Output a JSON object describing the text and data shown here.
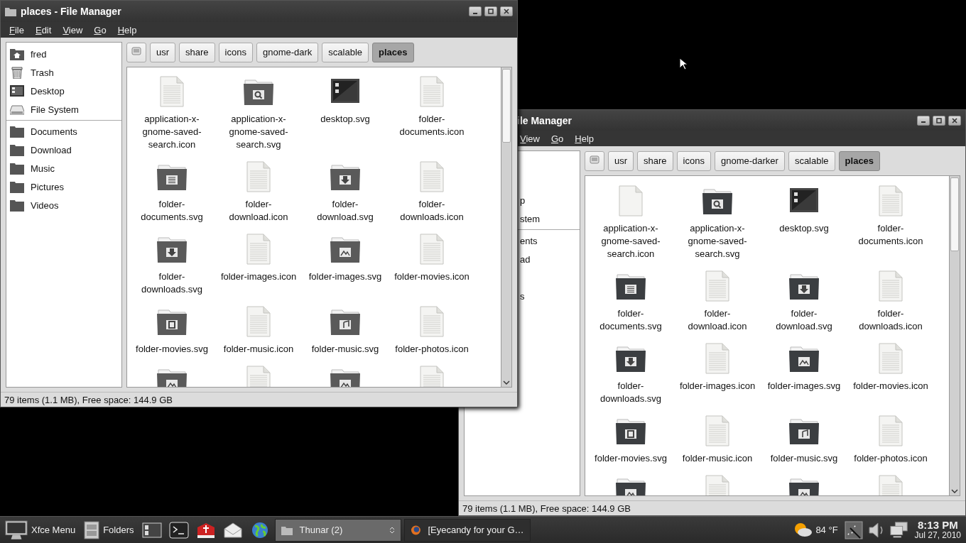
{
  "windows": [
    {
      "title": "places - File Manager",
      "menu": [
        "File",
        "Edit",
        "View",
        "Go",
        "Help"
      ],
      "sidebar": {
        "places": [
          {
            "label": "fred",
            "kind": "home"
          },
          {
            "label": "Trash",
            "kind": "trash"
          },
          {
            "label": "Desktop",
            "kind": "desktop"
          },
          {
            "label": "File System",
            "kind": "drive"
          }
        ],
        "bookmarks": [
          {
            "label": "Documents",
            "kind": "folder"
          },
          {
            "label": "Download",
            "kind": "folder"
          },
          {
            "label": "Music",
            "kind": "folder"
          },
          {
            "label": "Pictures",
            "kind": "folder"
          },
          {
            "label": "Videos",
            "kind": "folder"
          }
        ]
      },
      "path": [
        {
          "label": "usr",
          "selected": false
        },
        {
          "label": "share",
          "selected": false
        },
        {
          "label": "icons",
          "selected": false
        },
        {
          "label": "gnome-dark",
          "selected": false
        },
        {
          "label": "scalable",
          "selected": false
        },
        {
          "label": "places",
          "selected": true
        }
      ],
      "items": [
        {
          "name": "application-x-gnome-saved-search.icon",
          "kind": "document"
        },
        {
          "name": "application-x-gnome-saved-search.svg",
          "kind": "search-folder"
        },
        {
          "name": "desktop.svg",
          "kind": "desktop"
        },
        {
          "name": "folder-documents.icon",
          "kind": "document"
        },
        {
          "name": "folder-documents.svg",
          "kind": "documents-folder"
        },
        {
          "name": "folder-download.icon",
          "kind": "document"
        },
        {
          "name": "folder-download.svg",
          "kind": "download-folder"
        },
        {
          "name": "folder-downloads.icon",
          "kind": "document"
        },
        {
          "name": "folder-downloads.svg",
          "kind": "download-folder"
        },
        {
          "name": "folder-images.icon",
          "kind": "document"
        },
        {
          "name": "folder-images.svg",
          "kind": "images-folder"
        },
        {
          "name": "folder-movies.icon",
          "kind": "document"
        },
        {
          "name": "folder-movies.svg",
          "kind": "movies-folder"
        },
        {
          "name": "folder-music.icon",
          "kind": "document"
        },
        {
          "name": "folder-music.svg",
          "kind": "music-folder"
        },
        {
          "name": "folder-photos.icon",
          "kind": "document"
        },
        {
          "kind": "images-folder"
        },
        {
          "kind": "document"
        },
        {
          "kind": "images-folder"
        },
        {
          "kind": "document"
        }
      ],
      "status": "79 items (1.1 MB), Free space: 144.9 GB"
    },
    {
      "title": "ile Manager",
      "menu": [
        "View",
        "Go",
        "Help"
      ],
      "sidebar": {
        "places": [
          {
            "label": "p"
          },
          {
            "label": "stem"
          }
        ],
        "bookmarks": [
          {
            "label": "ents"
          },
          {
            "label": "ad"
          },
          {
            "label": "s"
          }
        ]
      },
      "path": [
        {
          "label": "usr",
          "selected": false
        },
        {
          "label": "share",
          "selected": false
        },
        {
          "label": "icons",
          "selected": false
        },
        {
          "label": "gnome-darker",
          "selected": false
        },
        {
          "label": "scalable",
          "selected": false
        },
        {
          "label": "places",
          "selected": true
        }
      ],
      "items": [
        {
          "name": "application-x-gnome-saved-search.icon",
          "kind": "blank"
        },
        {
          "name": "application-x-gnome-saved-search.svg",
          "kind": "search-folder"
        },
        {
          "name": "desktop.svg",
          "kind": "desktop"
        },
        {
          "name": "folder-documents.icon",
          "kind": "document"
        },
        {
          "name": "folder-documents.svg",
          "kind": "documents-folder"
        },
        {
          "name": "folder-download.icon",
          "kind": "document"
        },
        {
          "name": "folder-download.svg",
          "kind": "download-folder"
        },
        {
          "name": "folder-downloads.icon",
          "kind": "document"
        },
        {
          "name": "folder-downloads.svg",
          "kind": "download-folder"
        },
        {
          "name": "folder-images.icon",
          "kind": "document"
        },
        {
          "name": "folder-images.svg",
          "kind": "images-folder"
        },
        {
          "name": "folder-movies.icon",
          "kind": "document"
        },
        {
          "name": "folder-movies.svg",
          "kind": "movies-folder"
        },
        {
          "name": "folder-music.icon",
          "kind": "document"
        },
        {
          "name": "folder-music.svg",
          "kind": "music-folder"
        },
        {
          "name": "folder-photos.icon",
          "kind": "document"
        },
        {
          "kind": "images-folder"
        },
        {
          "kind": "document"
        },
        {
          "kind": "images-folder"
        },
        {
          "kind": "document"
        }
      ],
      "status": "79 items (1.1 MB), Free space: 144.9 GB"
    }
  ],
  "taskbar": {
    "menu": "Xfce Menu",
    "folders": "Folders",
    "launchers": [
      {
        "kind": "desktop"
      },
      {
        "kind": "terminal"
      },
      {
        "kind": "book"
      },
      {
        "kind": "mail"
      },
      {
        "kind": "globe"
      }
    ],
    "tasks": [
      {
        "label": "Thunar (2)",
        "kind": "folder",
        "selected": true
      },
      {
        "label": "[Eyecandy for your G…",
        "kind": "browser",
        "selected": false
      }
    ],
    "weather": "84 °F",
    "time": "8:13 PM",
    "date": "Jul 27, 2010"
  }
}
